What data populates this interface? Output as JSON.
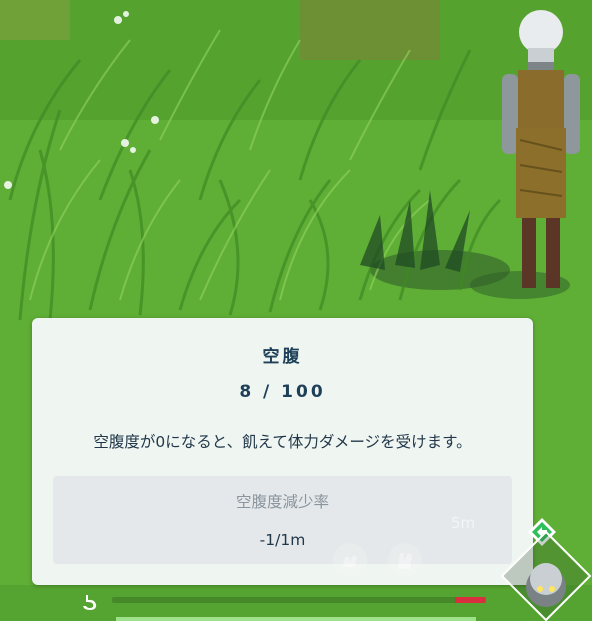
{
  "tooltip": {
    "title": "空腹",
    "value": "8 / 100",
    "description": "空腹度が0になると、飢えて体力ダメージを受けます。",
    "stat_label": "空腹度減少率",
    "stat_value": "-1/1m"
  },
  "hud": {
    "distance": "5m",
    "hunger_fraction": 0.08
  },
  "colors": {
    "title_text": "#1e3f58",
    "hunger_low": "#d8303f",
    "badge_green": "#2fbf5a"
  }
}
